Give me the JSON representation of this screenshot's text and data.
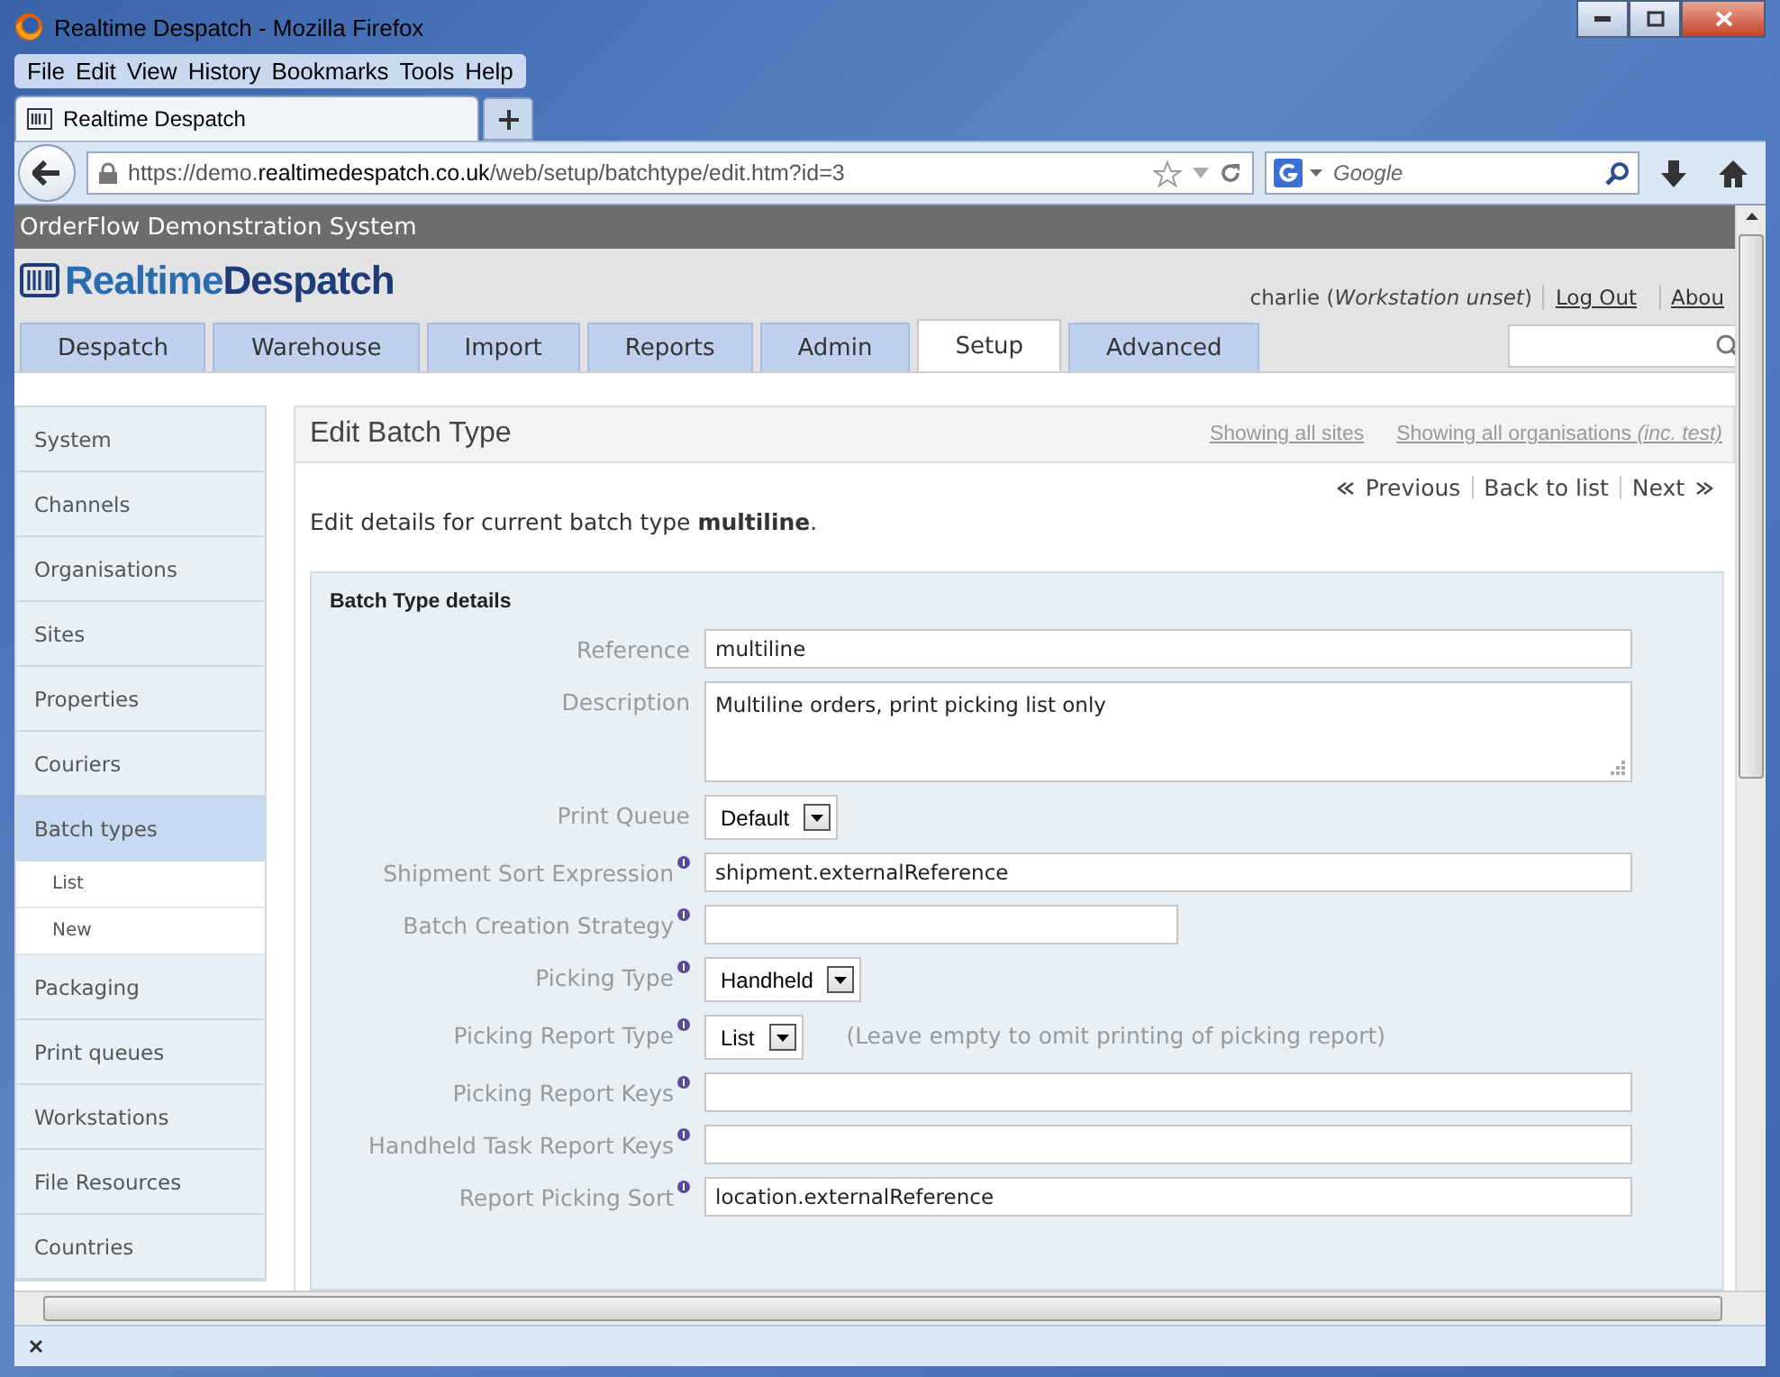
{
  "window": {
    "title": "Realtime Despatch - Mozilla Firefox"
  },
  "menu_bar": [
    "File",
    "Edit",
    "View",
    "History",
    "Bookmarks",
    "Tools",
    "Help"
  ],
  "browser_tabs": [
    {
      "label": "Realtime Despatch",
      "selected": true
    }
  ],
  "address_bar": {
    "url": "https://demo.**realtimedespatch.co.uk**/web/setup/batchtype/edit.htm?id=3"
  },
  "web_search": {
    "placeholder": "Google"
  },
  "site": {
    "system_name": "OrderFlow Demonstration System",
    "logo_part_1": "Realtime",
    "logo_part_2": "Despatch",
    "user_line": "charlie (*Workstation unset*)",
    "links": [
      "Log Out",
      "Abou"
    ]
  },
  "nav_tabs": [
    {
      "label": "Despatch",
      "selected": false
    },
    {
      "label": "Warehouse",
      "selected": false
    },
    {
      "label": "Import",
      "selected": false
    },
    {
      "label": "Reports",
      "selected": false
    },
    {
      "label": "Admin",
      "selected": false
    },
    {
      "label": "Setup",
      "selected": true
    },
    {
      "label": "Advanced",
      "selected": false
    }
  ],
  "sidebar": {
    "items": [
      {
        "label": "System",
        "selected": false
      },
      {
        "label": "Channels",
        "selected": false
      },
      {
        "label": "Organisations",
        "selected": false
      },
      {
        "label": "Sites",
        "selected": false
      },
      {
        "label": "Properties",
        "selected": false
      },
      {
        "label": "Couriers",
        "selected": false
      },
      {
        "label": "Batch types",
        "selected": true,
        "children": [
          {
            "label": "List"
          },
          {
            "label": "New"
          }
        ]
      },
      {
        "label": "Packaging",
        "selected": false
      },
      {
        "label": "Print queues",
        "selected": false
      },
      {
        "label": "Workstations",
        "selected": false
      },
      {
        "label": "File Resources",
        "selected": false
      },
      {
        "label": "Countries",
        "selected": false
      }
    ]
  },
  "page": {
    "title": "Edit Batch Type",
    "filters": [
      "Showing all sites",
      "Showing all organisations *(inc. test)*"
    ],
    "pager": {
      "previous": "Previous",
      "back": "Back to list",
      "next": "Next"
    },
    "intro": "Edit details for current batch type **multiline**."
  },
  "form": {
    "title": "Batch Type details",
    "fields": [
      {
        "label": "Reference",
        "kind": "text",
        "value": "multiline",
        "info": false
      },
      {
        "label": "Description",
        "kind": "textarea",
        "value": "Multiline orders, print picking list only",
        "info": false
      },
      {
        "label": "Print Queue",
        "kind": "select",
        "value": "Default",
        "info": false
      },
      {
        "label": "Shipment Sort Expression",
        "kind": "text",
        "value": "shipment.externalReference",
        "info": true
      },
      {
        "label": "Batch Creation Strategy",
        "kind": "short_text",
        "info": true
      },
      {
        "label": "Picking Type",
        "kind": "select",
        "value": "Handheld",
        "info": true
      },
      {
        "label": "Picking Report Type",
        "kind": "select",
        "value": "List",
        "info": true,
        "hint": "(Leave empty to omit printing of picking report)"
      },
      {
        "label": "Picking Report Keys",
        "kind": "text",
        "info": true
      },
      {
        "label": "Handheld Task Report Keys",
        "kind": "text",
        "info": true
      },
      {
        "label": "Report Picking Sort",
        "kind": "text",
        "value": "location.externalReference",
        "info": true
      }
    ]
  }
}
